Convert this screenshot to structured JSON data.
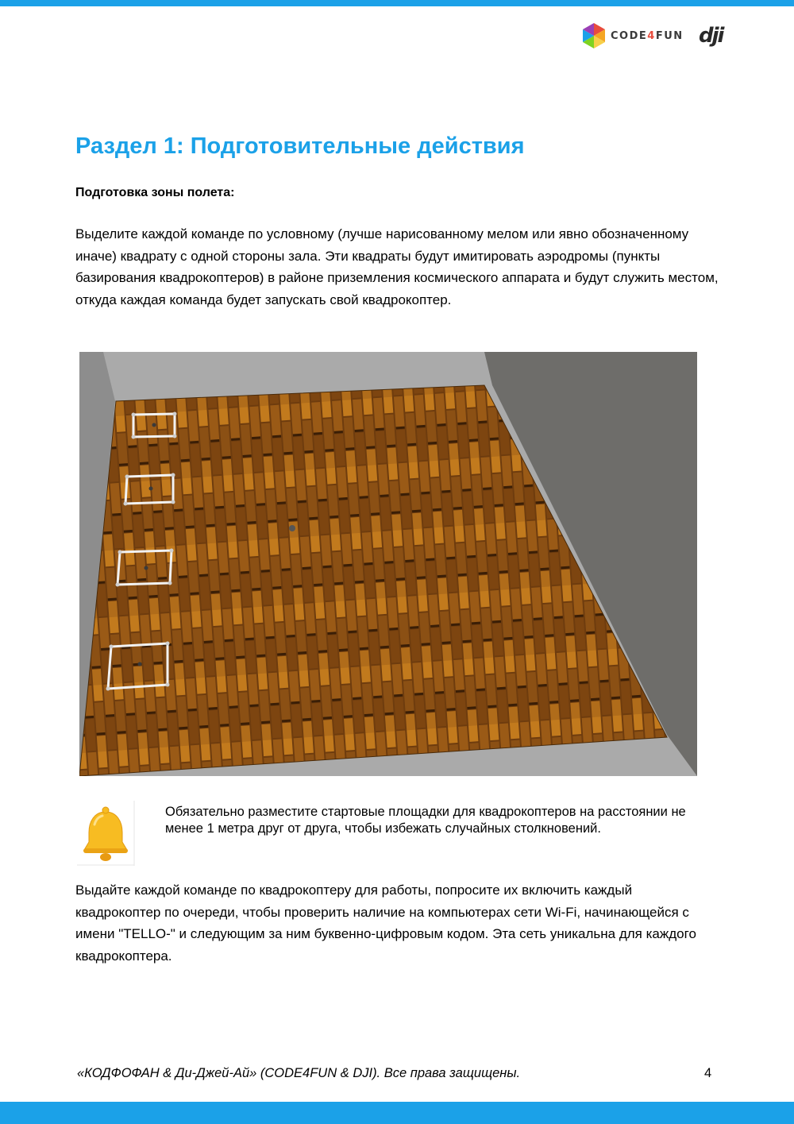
{
  "header": {
    "code4fun_logo_text": "CODE4FUN",
    "code4fun_logo_main": "CODE",
    "code4fun_logo_four": "4",
    "code4fun_logo_tail": "FUN",
    "dji_logo_text": "dji"
  },
  "section": {
    "title": "Раздел 1: Подготовительные действия",
    "subheading": "Подготовка зоны полета:",
    "paragraph1": "Выделите каждой команде по условному (лучше нарисованному мелом или явно обозначенному иначе) квадрату с одной стороны зала. Эти квадраты будут имитировать аэродромы (пункты базирования квадрокоптеров) в районе приземления космического аппарата и будут служить местом, откуда каждая команда будет запускать свой квадрокоптер.",
    "note": "Обязательно разместите стартовые площадки для квадрокоптеров на расстоянии не менее 1 метра друг от друга, чтобы избежать случайных столкновений.",
    "paragraph2": "Выдайте каждой команде по квадрокоптеру для работы, попросите их включить каждый квадрокоптер по очереди, чтобы проверить наличие на компьютерах сети Wi-Fi, начинающейся с имени \"TELLO-\" и следующим за ним буквенно-цифровым кодом. Эта сеть уникальна для каждого квадрокоптера."
  },
  "figure": {
    "icon": "floor-plan-image",
    "landing_pads": 4
  },
  "note_icon": "bell-icon",
  "footer": {
    "text": "«КОДФОФАН & Ди-Джей-Ай» (CODE4FUN & DJI). Все права защищены.",
    "page_number": "4"
  },
  "colors": {
    "accent": "#1ba1e8",
    "floor": "#7a4410"
  }
}
